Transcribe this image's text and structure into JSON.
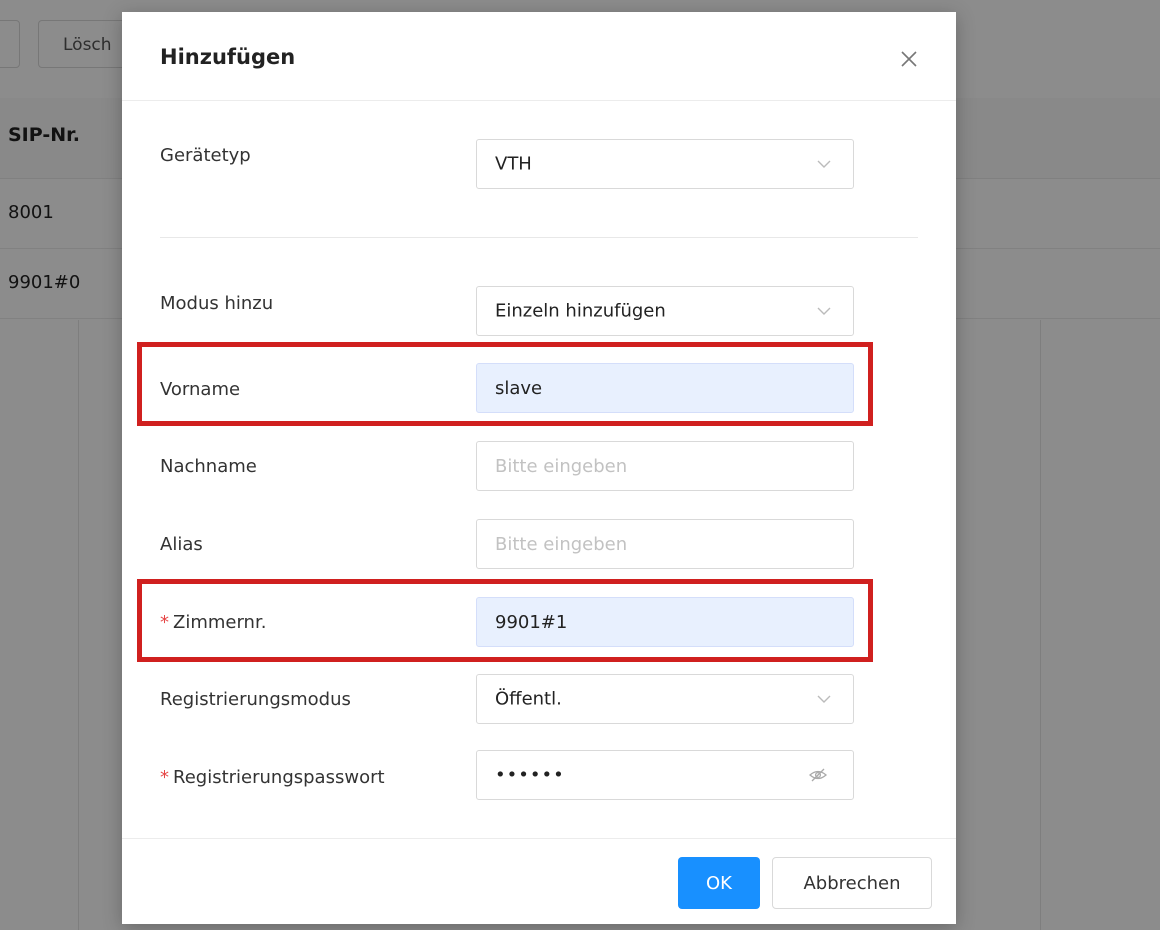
{
  "background": {
    "toolbar": {
      "delete_label": "Lösch"
    },
    "table": {
      "header": "SIP-Nr.",
      "rows": [
        "8001",
        "9901#0"
      ]
    }
  },
  "modal": {
    "title": "Hinzufügen",
    "close_icon": "close-icon",
    "fields": {
      "device_type": {
        "label": "Gerätetyp",
        "value": "VTH"
      },
      "add_mode": {
        "label": "Modus hinzu",
        "value": "Einzeln hinzufügen"
      },
      "first_name": {
        "label": "Vorname",
        "value": "slave"
      },
      "last_name": {
        "label": "Nachname",
        "placeholder": "Bitte eingeben"
      },
      "alias": {
        "label": "Alias",
        "placeholder": "Bitte eingeben"
      },
      "room_no": {
        "label": "Zimmernr.",
        "required_mark": "*",
        "value": "9901#1"
      },
      "reg_mode": {
        "label": "Registrierungsmodus",
        "value": "Öffentl."
      },
      "reg_password": {
        "label": "Registrierungspasswort",
        "required_mark": "*",
        "value": "••••••"
      }
    },
    "buttons": {
      "ok": "OK",
      "cancel": "Abbrechen"
    }
  },
  "colors": {
    "primary": "#1890ff",
    "highlight": "#d0201f",
    "required": "#e64545",
    "filled_bg": "#e8f0fe"
  }
}
